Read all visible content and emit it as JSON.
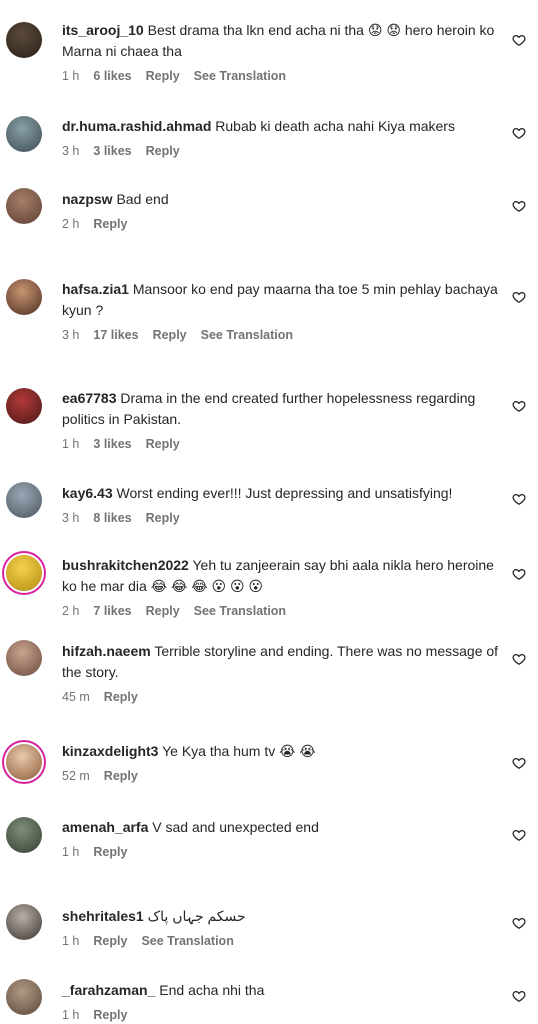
{
  "ui": {
    "reply_label": "Reply",
    "translate_label": "See Translation"
  },
  "comments": [
    {
      "username": "its_arooj_10",
      "text": "Best drama tha lkn end acha ni tha 😟 😟 hero heroin ko Marna ni chaea tha",
      "time": "1 h",
      "likes": "6 likes",
      "translation": true,
      "avatar_colors": [
        "#5a4a3a",
        "#2a2018"
      ]
    },
    {
      "username": "dr.huma.rashid.ahmad",
      "text": "Rubab ki death acha nahi Kiya makers",
      "time": "3 h",
      "likes": "3 likes",
      "translation": false,
      "avatar_colors": [
        "#8aa0a8",
        "#3b4a52"
      ]
    },
    {
      "username": "nazpsw",
      "text": "Bad end",
      "time": "2 h",
      "likes": "",
      "translation": false,
      "avatar_colors": [
        "#a87f6a",
        "#5b3f33"
      ]
    },
    {
      "username": "hafsa.zia1",
      "text": "Mansoor ko end pay maarna tha toe 5 min pehlay bachaya kyun ?",
      "time": "3 h",
      "likes": "17 likes",
      "translation": true,
      "avatar_colors": [
        "#c89570",
        "#4b2c22"
      ]
    },
    {
      "username": "ea67783",
      "text": "Drama in the end created further hopelessness regarding politics in Pakistan.",
      "time": "1 h",
      "likes": "3 likes",
      "translation": false,
      "avatar_colors": [
        "#b23a3a",
        "#4a1616"
      ]
    },
    {
      "username": "kay6.43",
      "text": "Worst ending ever!!! Just depressing and unsatisfying!",
      "time": "3 h",
      "likes": "8 likes",
      "translation": false,
      "avatar_colors": [
        "#9aa7b4",
        "#4b5560"
      ]
    },
    {
      "username": "bushrakitchen2022",
      "text": "Yeh tu zanjeerain say bhi aala nikla hero heroine ko he mar dia 😂 😂 😂 😮 😮 😮",
      "time": "2 h",
      "likes": "7 likes",
      "translation": true,
      "avatar_colors": [
        "#f2d24b",
        "#b58a12"
      ]
    },
    {
      "username": "hifzah.naeem",
      "text": "Terrible storyline and ending. There was no message of the story.",
      "time": "45 m",
      "likes": "",
      "translation": false,
      "avatar_colors": [
        "#c9a48f",
        "#6b4a3c"
      ]
    },
    {
      "username": "kinzaxdelight3",
      "text": "Ye Kya tha hum tv 😭 😭",
      "time": "52 m",
      "likes": "",
      "translation": false,
      "avatar_colors": [
        "#e8c9a9",
        "#8c5c3c"
      ]
    },
    {
      "username": "amenah_arfa",
      "text": "V sad and unexpected end",
      "time": "1 h",
      "likes": "",
      "translation": false,
      "avatar_colors": [
        "#7f8f7a",
        "#333d30"
      ]
    },
    {
      "username": "shehritales1",
      "text": "حسکم جہاں پاک",
      "time": "1 h",
      "likes": "",
      "translation": true,
      "avatar_colors": [
        "#b8b0a8",
        "#3a3430"
      ]
    },
    {
      "username": "_farahzaman_",
      "text": "End acha nhi tha",
      "time": "1 h",
      "likes": "",
      "translation": false,
      "avatar_colors": [
        "#b09a86",
        "#5b4636"
      ]
    }
  ]
}
